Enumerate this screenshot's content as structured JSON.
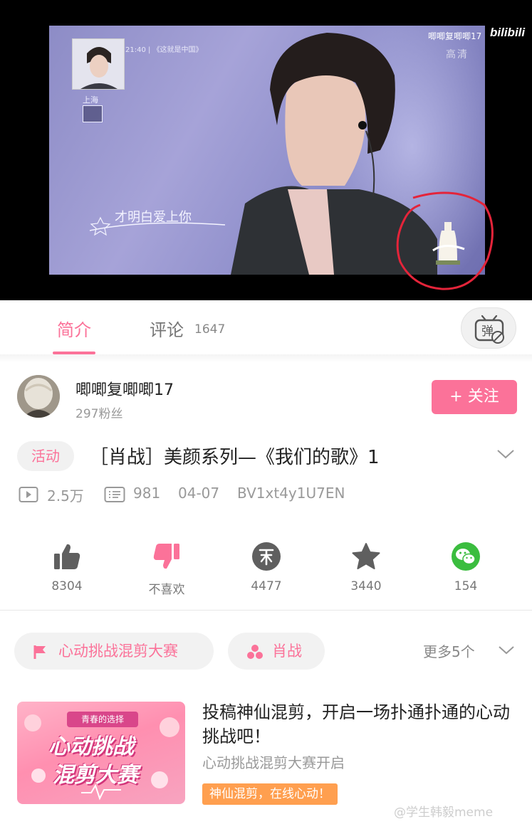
{
  "player": {
    "uploader_watermark": "唧唧复唧唧17",
    "logo_text": "bilibili",
    "broadcast_time": "21:40",
    "broadcast_show": "《这就是中国》",
    "inset_city": "上海",
    "hd_label": "高清",
    "lyric": "才明白爱上你"
  },
  "tabs": {
    "intro": "简介",
    "comments": "评论",
    "comments_count": "1647",
    "danmaku_icon": "danmaku-off-icon"
  },
  "uploader": {
    "name": "唧唧复唧唧17",
    "fans": "297粉丝",
    "follow_label": "+ 关注"
  },
  "video": {
    "activity_tag": "活动",
    "title": "［肖战］美颜系列—《我们的歌》1",
    "views": "2.5万",
    "danmaku_count": "981",
    "date": "04-07",
    "bvid": "BV1xt4y1U7EN"
  },
  "actions": [
    {
      "icon": "thumbs-up-icon",
      "label": "8304"
    },
    {
      "icon": "thumbs-down-icon",
      "label": "不喜欢"
    },
    {
      "icon": "coin-icon",
      "label": "4477"
    },
    {
      "icon": "star-icon",
      "label": "3440"
    },
    {
      "icon": "wechat-icon",
      "label": "154"
    }
  ],
  "chips": {
    "event": "心动挑战混剪大赛",
    "tag": "肖战",
    "more": "更多5个"
  },
  "promo": {
    "image_ribbon": "青春的选择",
    "image_line1": "心动挑战",
    "image_line2": "混剪大赛",
    "title": "投稿神仙混剪，开启一场扑通扑通的心动挑战吧！",
    "subtitle": "心动挑战混剪大赛开启",
    "badge": "神仙混剪，在线心动！"
  },
  "weibo_watermark": "@学生韩毅meme",
  "colors": {
    "accent": "#fb7299",
    "badge_orange": "#ff9f4f",
    "wechat_green": "#3bbd3f"
  }
}
